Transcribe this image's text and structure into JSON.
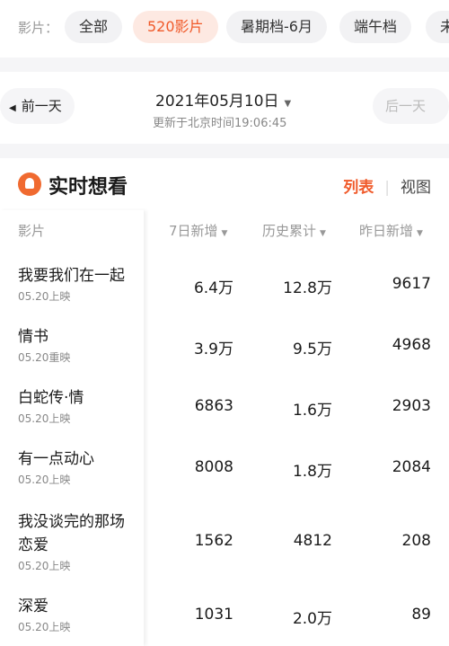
{
  "filter": {
    "label": "影片：",
    "chips": [
      "全部",
      "520影片",
      "暑期档-6月",
      "端午档",
      "未"
    ]
  },
  "datebar": {
    "prev": "前一天",
    "date": "2021年05月10日",
    "updated": "更新于北京时间19:06:45",
    "next": "后一天"
  },
  "card": {
    "title": "实时想看",
    "view_list": "列表",
    "view_chart": "视图",
    "headers": {
      "film": "影片",
      "week": "7日新增",
      "total": "历史累计",
      "yesterday": "昨日新增"
    },
    "rows": [
      {
        "name": "我要我们在一起",
        "release": "05.20上映",
        "week": "6.4万",
        "total": "12.8万",
        "yesterday": "9617"
      },
      {
        "name": "情书",
        "release": "05.20重映",
        "week": "3.9万",
        "total": "9.5万",
        "yesterday": "4968"
      },
      {
        "name": "白蛇传·情",
        "release": "05.20上映",
        "week": "6863",
        "total": "1.6万",
        "yesterday": "2903"
      },
      {
        "name": "有一点动心",
        "release": "05.20上映",
        "week": "8008",
        "total": "1.8万",
        "yesterday": "2084"
      },
      {
        "name": "我没谈完的那场",
        "name2": "恋爱",
        "release": "05.20上映",
        "week": "1562",
        "total": "4812",
        "yesterday": "208"
      },
      {
        "name": "深爱",
        "release": "05.20上映",
        "week": "1031",
        "total": "2.0万",
        "yesterday": "89"
      }
    ]
  },
  "colors": {
    "accent": "#f05a2a",
    "active_chip_bg": "#fde9e2",
    "muted": "#999999"
  },
  "icons": {
    "title": "popcorn-icon",
    "sort": "triangle-down-icon",
    "prev": "arrow-left-icon",
    "next": "arrow-right-icon"
  }
}
